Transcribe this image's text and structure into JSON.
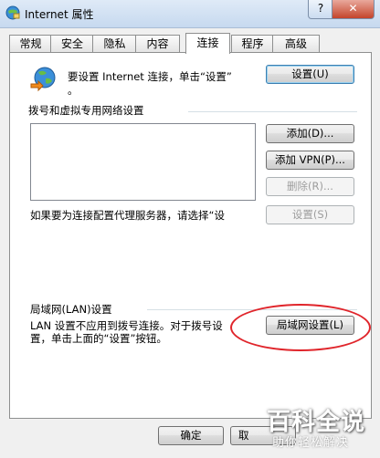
{
  "window": {
    "title": "Internet 属性",
    "help_label": "?",
    "close_label": "✕",
    "icon": "internet-options-icon"
  },
  "tabs": [
    "常规",
    "安全",
    "隐私",
    "内容",
    "连接",
    "程序",
    "高级"
  ],
  "active_tab": "连接",
  "setup": {
    "text_line1": "要设置 Internet 连接，单击“设置”",
    "text_line2": "。",
    "button": "设置(U)",
    "icon": "globe-network-icon"
  },
  "dialup": {
    "heading": "拨号和虚拟专用网络设置",
    "add_button": "添加(D)...",
    "add_vpn_button": "添加 VPN(P)...",
    "remove_button": "删除(R)...",
    "proxy_text": "如果要为连接配置代理服务器，请选择“设",
    "settings_button": "设置(S)"
  },
  "lan": {
    "heading": "局域网(LAN)设置",
    "text_line1": "LAN 设置不应用到拨号连接。对于拨号设",
    "text_line2": "置，单击上面的“设置”按钮。",
    "button": "局域网设置(L)"
  },
  "footer": {
    "ok_button": "确定",
    "cancel_button": "取"
  },
  "watermark": {
    "main": "百科全说",
    "sub": "助你轻松解决"
  },
  "colors": {
    "annotation_ellipse": "#e0252b",
    "focus_border": "#3c7fb1"
  }
}
